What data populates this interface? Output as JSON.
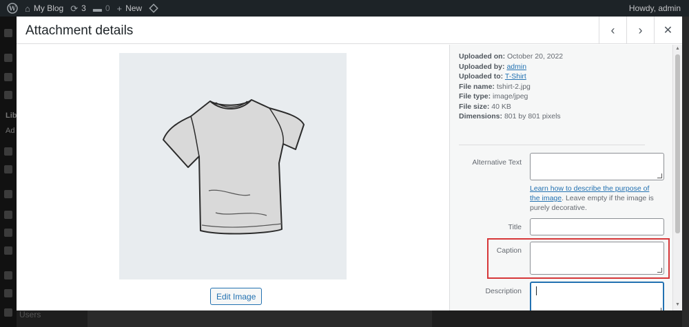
{
  "adminbar": {
    "site_name": "My Blog",
    "updates_count": "3",
    "comments_count": "0",
    "new_label": "New",
    "howdy": "Howdy, admin"
  },
  "sidemenu": {
    "library_label": "Lib",
    "add_label": "Ad",
    "users_label": "Users"
  },
  "modal": {
    "title": "Attachment details",
    "edit_image_label": "Edit Image"
  },
  "details": {
    "uploaded_on_label": "Uploaded on:",
    "uploaded_on": "October 20, 2022",
    "uploaded_by_label": "Uploaded by:",
    "uploaded_by": "admin",
    "uploaded_to_label": "Uploaded to:",
    "uploaded_to": "T-Shirt",
    "file_name_label": "File name:",
    "file_name": "tshirt-2.jpg",
    "file_type_label": "File type:",
    "file_type": "image/jpeg",
    "file_size_label": "File size:",
    "file_size": "40 KB",
    "dimensions_label": "Dimensions:",
    "dimensions": "801 by 801 pixels"
  },
  "form": {
    "alt_label": "Alternative Text",
    "alt_help_link": "Learn how to describe the purpose of the image",
    "alt_help_text": ". Leave empty if the image is purely decorative.",
    "title_label": "Title",
    "caption_label": "Caption",
    "description_label": "Description"
  },
  "colors": {
    "accent": "#2271b1",
    "highlight": "#d63638"
  }
}
